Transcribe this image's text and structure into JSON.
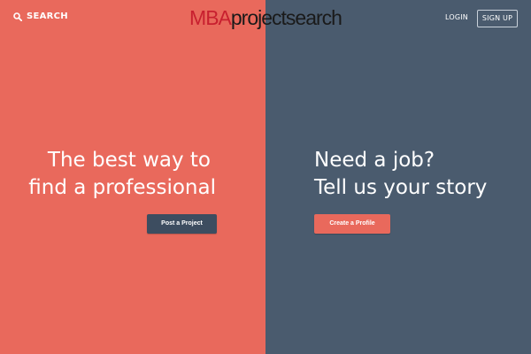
{
  "header": {
    "search_label": "SEARCH",
    "logo_prefix": "MBA",
    "logo_suffix": "projectsearch",
    "login_label": "LOGIN",
    "signup_label": "SIGN UP"
  },
  "left": {
    "heading_line1": "The best way to",
    "heading_line2": "find a professional",
    "button_label": "Post a Project"
  },
  "right": {
    "heading_line1": "Need a job?",
    "heading_line2": "Tell us your story",
    "button_label": "Create a Profile"
  },
  "colors": {
    "left_panel": "#e9695c",
    "right_panel": "#4a5b6e",
    "logo_accent": "#c8202f",
    "post_button": "#3d4d60",
    "create_button": "#e9695c"
  },
  "icons": {
    "search": "search-icon"
  }
}
